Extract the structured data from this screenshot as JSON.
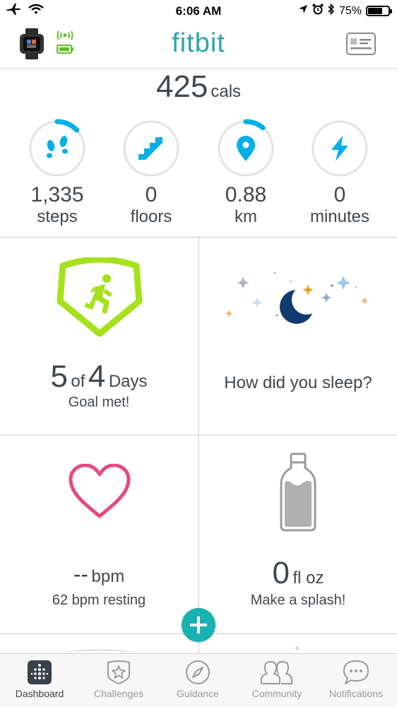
{
  "status_bar": {
    "time": "6:06 AM",
    "battery": "75%",
    "battery_level": 0.75
  },
  "header": {
    "logo": "fitbit"
  },
  "summary": {
    "calories_value": "425",
    "calories_unit": "cals"
  },
  "stats": [
    {
      "id": "steps",
      "value": "1,335",
      "unit": "steps",
      "icon": "footsteps-icon",
      "progress": 0.13
    },
    {
      "id": "floors",
      "value": "0",
      "unit": "floors",
      "icon": "stairs-icon",
      "progress": 0
    },
    {
      "id": "distance",
      "value": "0.88",
      "unit": "km",
      "icon": "location-pin-icon",
      "progress": 0.11
    },
    {
      "id": "minutes",
      "value": "0",
      "unit": "minutes",
      "icon": "lightning-icon",
      "progress": 0
    }
  ],
  "tiles": {
    "exercise": {
      "achieved": "5",
      "of_label": "of",
      "goal": "4",
      "period": "Days",
      "subtitle": "Goal met!"
    },
    "sleep": {
      "prompt": "How did you sleep?"
    },
    "heart": {
      "value": "--",
      "unit": "bpm",
      "subtitle": "62 bpm resting"
    },
    "water": {
      "value": "0",
      "unit": "fl oz",
      "subtitle": "Make a splash!"
    }
  },
  "tabs": [
    {
      "label": "Dashboard",
      "icon": "dashboard-icon",
      "active": true
    },
    {
      "label": "Challenges",
      "icon": "star-badge-icon",
      "active": false
    },
    {
      "label": "Guidance",
      "icon": "compass-icon",
      "active": false
    },
    {
      "label": "Community",
      "icon": "people-icon",
      "active": false
    },
    {
      "label": "Notifications",
      "icon": "chat-bubble-icon",
      "active": false
    }
  ],
  "colors": {
    "brand": "#2aa7a6",
    "accent_blue": "#00b0e6",
    "lime": "#a5e21c",
    "heart": "#e34b7f",
    "moon": "#123b70",
    "fab": "#18b2b0"
  }
}
